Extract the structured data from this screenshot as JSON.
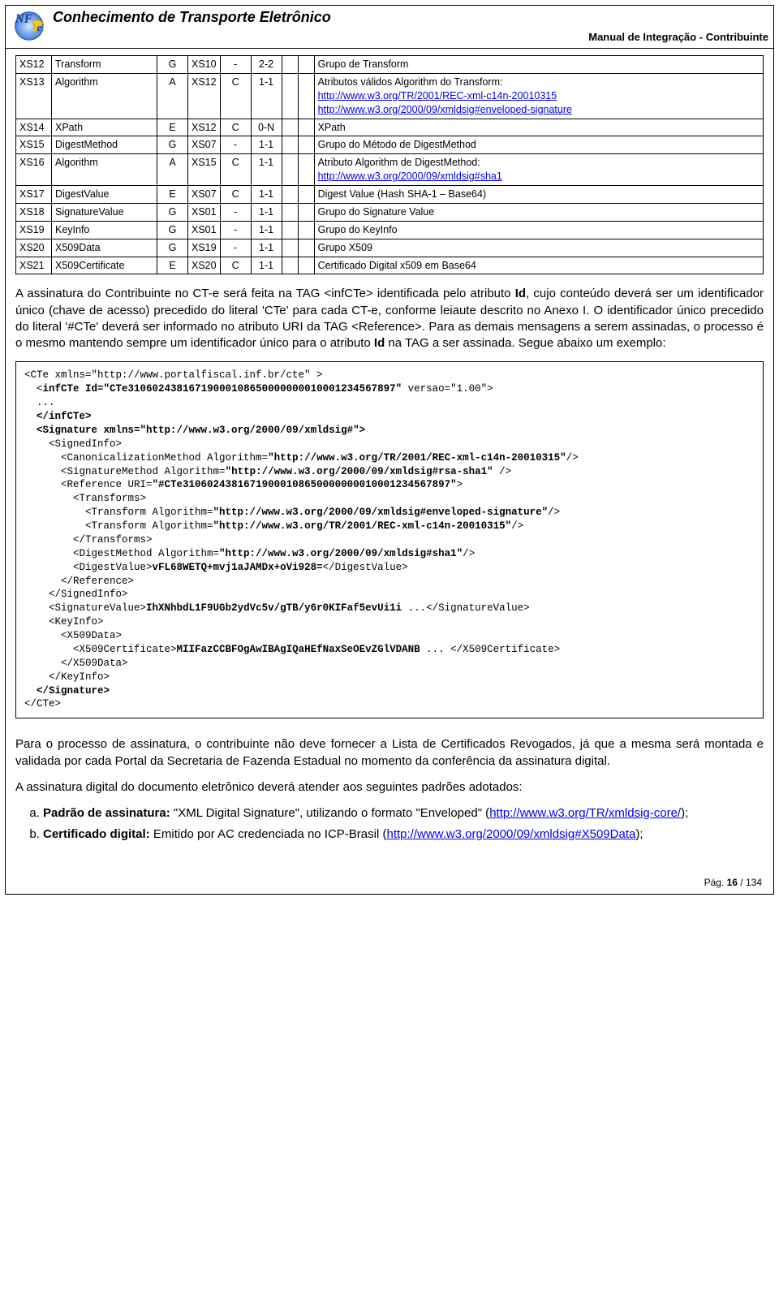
{
  "header": {
    "title": "Conhecimento de Transporte Eletrônico",
    "subtitle": "Manual de Integração - Contribuinte"
  },
  "table": {
    "rows": [
      {
        "c0": "XS12",
        "c1": "Transform",
        "c2": "G",
        "c3": "XS10",
        "c4": "-",
        "c5": "2-2",
        "c6": "",
        "c7": "",
        "c8": "Grupo de Transform"
      },
      {
        "c0": "XS13",
        "c1": "Algorithm",
        "c2": "A",
        "c3": "XS12",
        "c4": "C",
        "c5": "1-1",
        "c6": "",
        "c7": "",
        "c8": "Atributos válidos Algorithm do Transform:",
        "urls": [
          "http://www.w3.org/TR/2001/REC-xml-c14n-20010315",
          "http://www.w3.org/2000/09/xmldsig#enveloped-signature"
        ]
      },
      {
        "c0": "XS14",
        "c1": "XPath",
        "c2": "E",
        "c3": "XS12",
        "c4": "C",
        "c5": "0-N",
        "c6": "",
        "c7": "",
        "c8": "XPath"
      },
      {
        "c0": "XS15",
        "c1": "DigestMethod",
        "c2": "G",
        "c3": "XS07",
        "c4": "-",
        "c5": "1-1",
        "c6": "",
        "c7": "",
        "c8": "Grupo do Método de DigestMethod"
      },
      {
        "c0": "XS16",
        "c1": "Algorithm",
        "c2": "A",
        "c3": "XS15",
        "c4": "C",
        "c5": "1-1",
        "c6": "",
        "c7": "",
        "c8": "Atributo Algorithm de DigestMethod:",
        "urls": [
          "http://www.w3.org/2000/09/xmldsig#sha1"
        ]
      },
      {
        "c0": "XS17",
        "c1": "DigestValue",
        "c2": "E",
        "c3": "XS07",
        "c4": "C",
        "c5": "1-1",
        "c6": "",
        "c7": "",
        "c8": "Digest Value (Hash SHA-1 – Base64)"
      },
      {
        "c0": "XS18",
        "c1": "SignatureValue",
        "c2": "G",
        "c3": "XS01",
        "c4": "-",
        "c5": "1-1",
        "c6": "",
        "c7": "",
        "c8": "Grupo do Signature Value"
      },
      {
        "c0": "XS19",
        "c1": "KeyInfo",
        "c2": "G",
        "c3": "XS01",
        "c4": "-",
        "c5": "1-1",
        "c6": "",
        "c7": "",
        "c8": "Grupo do KeyInfo"
      },
      {
        "c0": "XS20",
        "c1": "X509Data",
        "c2": "G",
        "c3": "XS19",
        "c4": "-",
        "c5": "1-1",
        "c6": "",
        "c7": "",
        "c8": "Grupo X509"
      },
      {
        "c0": "XS21",
        "c1": "X509Certificate",
        "c2": "E",
        "c3": "XS20",
        "c4": "C",
        "c5": "1-1",
        "c6": "",
        "c7": "",
        "c8": "Certificado Digital x509 em Base64"
      }
    ]
  },
  "para1": "A assinatura do Contribuinte no CT-e será feita na TAG <infCTe> identificada pelo atributo Id, cujo conteúdo deverá ser um identificador único (chave de acesso) precedido do literal 'CTe' para cada CT-e, conforme leiaute descrito no Anexo I. O identificador único precedido do literal '#CTe' deverá ser informado no atributo URI da TAG <Reference>. Para as demais mensagens a serem assinadas, o processo é o mesmo mantendo sempre um identificador único para o atributo Id na TAG a ser assinada. Segue abaixo um exemplo:",
  "code": {
    "l01": "<CTe xmlns=\"http://www.portalfiscal.inf.br/cte\" >",
    "l02": "  <infCTe Id=\"CTe31060243816719000108650000000010001234567897\" versao=\"1.00\">",
    "l03": "  ...",
    "l04": "  </infCTe>",
    "l05": "  <Signature xmlns=\"http://www.w3.org/2000/09/xmldsig#\">",
    "l06": "    <SignedInfo>",
    "l07": "      <CanonicalizationMethod Algorithm=\"http://www.w3.org/TR/2001/REC-xml-c14n-20010315\"/>",
    "l08": "      <SignatureMethod Algorithm=\"http://www.w3.org/2000/09/xmldsig#rsa-sha1\" />",
    "l09": "      <Reference URI=\"#CTe31060243816719000108650000000010001234567897\">",
    "l10": "        <Transforms>",
    "l11": "          <Transform Algorithm=\"http://www.w3.org/2000/09/xmldsig#enveloped-signature\"/>",
    "l12": "          <Transform Algorithm=\"http://www.w3.org/TR/2001/REC-xml-c14n-20010315\"/>",
    "l13": "        </Transforms>",
    "l14": "        <DigestMethod Algorithm=\"http://www.w3.org/2000/09/xmldsig#sha1\"/>",
    "l15": "        <DigestValue>vFL68WETQ+mvj1aJAMDx+oVi928=</DigestValue>",
    "l16": "      </Reference>",
    "l17": "    </SignedInfo>",
    "l18": "    <SignatureValue>IhXNhbdL1F9UGb2ydVc5v/gTB/y6r0KIFaf5evUi1i ...</SignatureValue>",
    "l19": "    <KeyInfo>",
    "l20": "      <X509Data>",
    "l21": "        <X509Certificate>MIIFazCCBFOgAwIBAgIQaHEfNaxSeOEvZGlVDANB ... </X509Certificate>",
    "l22": "      </X509Data>",
    "l23": "    </KeyInfo>",
    "l24": "  </Signature>",
    "l25": "</CTe>"
  },
  "para2": "Para o processo de assinatura, o contribuinte não deve fornecer a Lista de Certificados Revogados, já que a mesma será montada e validada por cada Portal da Secretaria de Fazenda Estadual no momento da conferência da assinatura digital.",
  "para3": "A assinatura digital do documento eletrônico deverá atender aos seguintes padrões adotados:",
  "list": {
    "a": {
      "lead": "Padrão de assinatura:",
      "rest": " \"XML Digital Signature\", utilizando o formato \"Enveloped\" (",
      "url": "http://www.w3.org/TR/xmldsig-core/",
      "suffix": ");"
    },
    "b": {
      "lead": "Certificado digital:",
      "rest": " Emitido por AC credenciada no ICP-Brasil (",
      "url": "http://www.w3.org/2000/09/xmldsig#X509Data",
      "suffix": ");"
    }
  },
  "footer": {
    "label": "Pág. ",
    "page": "16",
    "sep": " / ",
    "total": "134"
  }
}
